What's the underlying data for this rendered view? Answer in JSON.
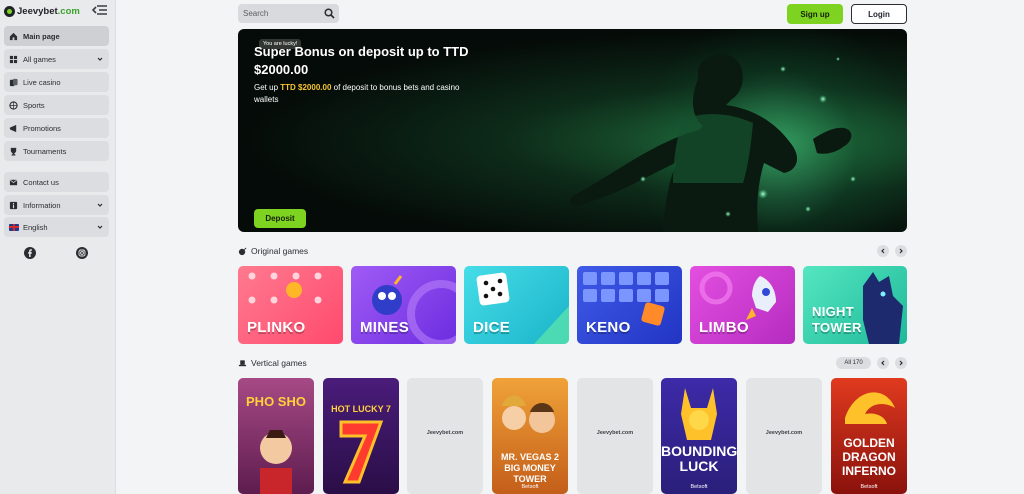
{
  "brand": {
    "name": "Jeevybet",
    "tld": ".com"
  },
  "sidebar": {
    "items": [
      {
        "label": "Main page",
        "icon": "home-icon",
        "active": true
      },
      {
        "label": "All games",
        "icon": "games-icon",
        "dropdown": true
      },
      {
        "label": "Live casino",
        "icon": "cards-icon"
      },
      {
        "label": "Sports",
        "icon": "sports-icon"
      },
      {
        "label": "Promotions",
        "icon": "promo-icon"
      },
      {
        "label": "Tournaments",
        "icon": "trophy-icon"
      }
    ],
    "secondary": [
      {
        "label": "Contact us",
        "icon": "mail-icon"
      },
      {
        "label": "Information",
        "icon": "info-icon",
        "dropdown": true
      },
      {
        "label": "English",
        "icon": "uk-flag-icon",
        "dropdown": true
      }
    ],
    "social": [
      "facebook-icon",
      "instagram-icon"
    ]
  },
  "header": {
    "search_placeholder": "Search",
    "signup_label": "Sign up",
    "login_label": "Login"
  },
  "banner": {
    "badge": "You are lucky!",
    "title": "Super Bonus on deposit up to TTD $2000.00",
    "subtitle_prefix": "Get up ",
    "subtitle_highlight": "TTD $2000.00",
    "subtitle_suffix": " of deposit to bonus bets and casino wallets",
    "cta": "Deposit"
  },
  "original_games": {
    "title": "Original games",
    "games": [
      {
        "name": "PLINKO",
        "color": "#ff5b7c"
      },
      {
        "name": "MINES",
        "color": "#8b3cf0"
      },
      {
        "name": "DICE",
        "color": "#23c7d8"
      },
      {
        "name": "KENO",
        "color": "#3148d6"
      },
      {
        "name": "LIMBO",
        "color": "#d63ad2"
      },
      {
        "name": "NIGHT TOWER",
        "color": "#3ddbb4"
      }
    ]
  },
  "vertical_games": {
    "title": "Vertical games",
    "all_label": "All",
    "count": "170",
    "games": [
      {
        "title": "PHO SHO",
        "provider": "",
        "placeholder": false
      },
      {
        "title": "HOT LUCKY 7",
        "provider": "",
        "placeholder": false
      },
      {
        "title": "",
        "provider": "",
        "placeholder": true,
        "logo": "Jeevybet.com"
      },
      {
        "title": "MR. VEGAS 2 BIG MONEY TOWER",
        "provider": "Betsoft",
        "placeholder": false
      },
      {
        "title": "",
        "provider": "",
        "placeholder": true,
        "logo": "Jeevybet.com"
      },
      {
        "title": "BOUNDING LUCK",
        "provider": "Betsoft",
        "placeholder": false
      },
      {
        "title": "",
        "provider": "",
        "placeholder": true,
        "logo": "Jeevybet.com"
      },
      {
        "title": "GOLDEN DRAGON INFERNO",
        "provider": "Betsoft",
        "placeholder": false
      }
    ]
  },
  "colors": {
    "accent": "#7ed321",
    "sidebar_bg": "#e9eaec",
    "page_bg": "#f3f4f6"
  }
}
